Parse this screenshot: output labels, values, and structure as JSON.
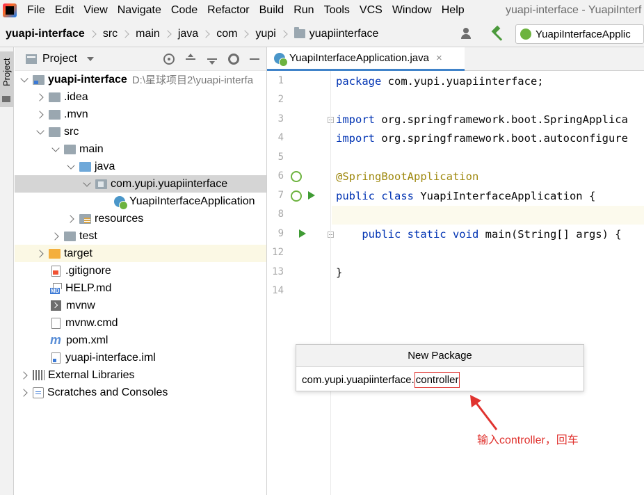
{
  "menubar": {
    "items": [
      "File",
      "Edit",
      "View",
      "Navigate",
      "Code",
      "Refactor",
      "Build",
      "Run",
      "Tools",
      "VCS",
      "Window",
      "Help"
    ],
    "window_title": "yuapi-interface - YuapiInterf"
  },
  "navbar": {
    "crumbs": [
      "yuapi-interface",
      "src",
      "main",
      "java",
      "com",
      "yupi",
      "yuapiinterface"
    ],
    "run_config": "YuapiInterfaceApplic"
  },
  "toolstrip": {
    "project_tab": "Project"
  },
  "project_panel": {
    "title": "Project",
    "tree": [
      {
        "label": "yuapi-interface",
        "path": "D:\\星球项目2\\yuapi-interfa"
      },
      {
        "label": ".idea"
      },
      {
        "label": ".mvn"
      },
      {
        "label": "src"
      },
      {
        "label": "main"
      },
      {
        "label": "java"
      },
      {
        "label": "com.yupi.yuapiinterface"
      },
      {
        "label": "YuapiInterfaceApplication"
      },
      {
        "label": "resources"
      },
      {
        "label": "test"
      },
      {
        "label": "target"
      },
      {
        "label": ".gitignore"
      },
      {
        "label": "HELP.md"
      },
      {
        "label": "mvnw"
      },
      {
        "label": "mvnw.cmd"
      },
      {
        "label": "pom.xml"
      },
      {
        "label": "yuapi-interface.iml"
      },
      {
        "label": "External Libraries"
      },
      {
        "label": "Scratches and Consoles"
      }
    ]
  },
  "editor": {
    "tab_label": "YuapiInterfaceApplication.java",
    "tab_close": "×",
    "line_numbers": [
      "1",
      "2",
      "3",
      "4",
      "5",
      "6",
      "7",
      "8",
      "9",
      "12",
      "13",
      "14"
    ],
    "code": [
      {
        "kw": "package",
        "rest": " com.yupi.yuapiinterface;"
      },
      {
        "kw": "",
        "rest": ""
      },
      {
        "kw": "import",
        "rest": " org.springframework.boot.SpringApplica"
      },
      {
        "kw": "import",
        "rest": " org.springframework.boot.autoconfigure"
      },
      {
        "kw": "",
        "rest": ""
      },
      {
        "ann": "@SpringBootApplication"
      },
      {
        "kw": "public class",
        "rest": " YuapiInterfaceApplication {"
      },
      {
        "kw": "",
        "rest": ""
      },
      {
        "kw": "    public static void",
        "rest": " main(String[] args) {"
      },
      {
        "kw": "",
        "rest": ""
      },
      {
        "kw": "",
        "rest": "}"
      },
      {
        "kw": "",
        "rest": ""
      }
    ]
  },
  "popup": {
    "title": "New Package",
    "input_prefix": "com.yupi.yuapiinterface.",
    "input_typed": "controller"
  },
  "annotation": {
    "text": "输入controller，回车",
    "color": "#e0332f"
  }
}
